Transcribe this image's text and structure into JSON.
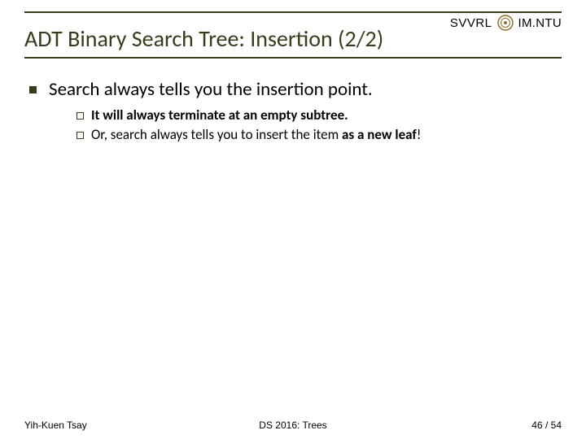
{
  "header": {
    "org_left": "SVVRL",
    "org_right": "IM.NTU",
    "title": "ADT Binary Search Tree: Insertion (2/2)"
  },
  "bullets": {
    "top": "Search always tells you the insertion point.",
    "sub1_bold": "It will always terminate at an empty subtree.",
    "sub2_prefix": "Or, search always tells you to insert the item ",
    "sub2_bold": "as a new leaf",
    "sub2_suffix": "!"
  },
  "footer": {
    "left": "Yih-Kuen Tsay",
    "center": "DS 2016: Trees",
    "right": "46 / 54"
  }
}
